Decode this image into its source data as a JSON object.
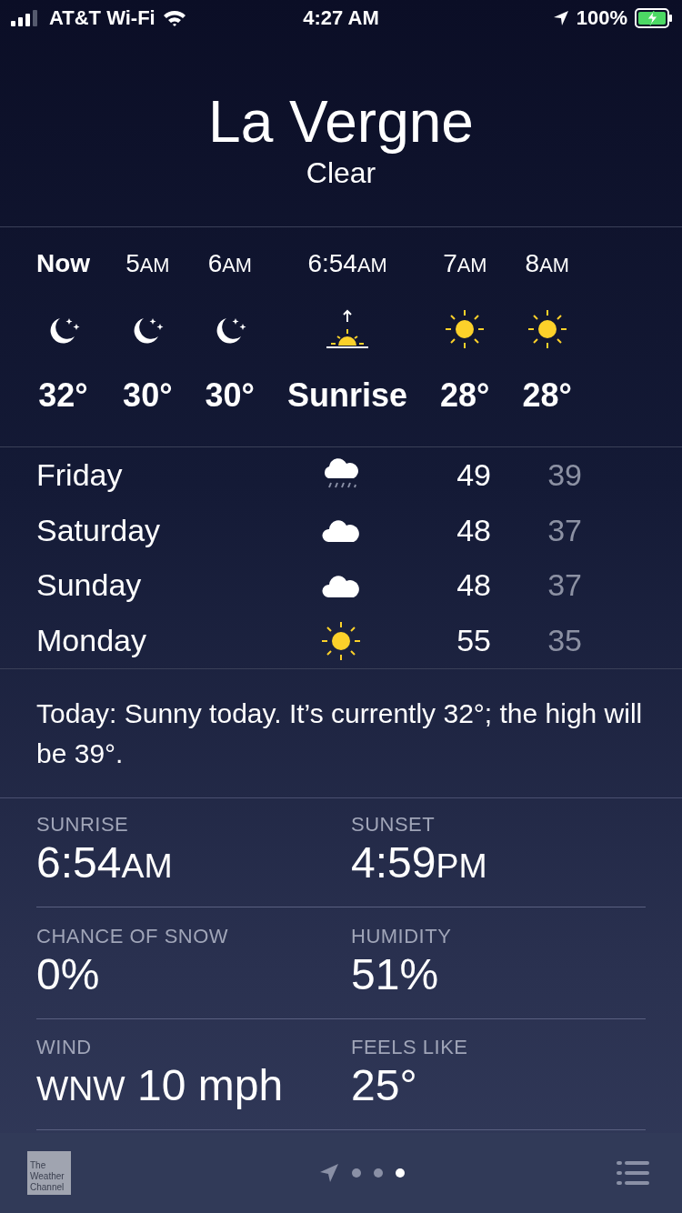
{
  "status_bar": {
    "carrier": "AT&T Wi-Fi",
    "time": "4:27 AM",
    "battery": "100%",
    "charging": true
  },
  "location": {
    "city": "La Vergne",
    "condition": "Clear"
  },
  "hourly": [
    {
      "time": "Now",
      "kind": "moon",
      "temp": "32°",
      "bold": true
    },
    {
      "time": "5",
      "period": "AM",
      "kind": "moon",
      "temp": "30°",
      "bold": false
    },
    {
      "time": "6",
      "period": "AM",
      "kind": "moon",
      "temp": "30°",
      "bold": false
    },
    {
      "time": "6:54",
      "period": "AM",
      "kind": "sunrise",
      "temp": "Sunrise",
      "bold": false
    },
    {
      "time": "7",
      "period": "AM",
      "kind": "sun",
      "temp": "28°",
      "bold": false
    },
    {
      "time": "8",
      "period": "AM",
      "kind": "sun",
      "temp": "28°",
      "bold": false
    }
  ],
  "daily": [
    {
      "day": "Friday",
      "kind": "rain",
      "high": "49",
      "low": "39"
    },
    {
      "day": "Saturday",
      "kind": "cloud",
      "high": "48",
      "low": "37"
    },
    {
      "day": "Sunday",
      "kind": "cloud",
      "high": "48",
      "low": "37"
    },
    {
      "day": "Monday",
      "kind": "sun",
      "high": "55",
      "low": "35"
    }
  ],
  "summary": "Today: Sunny today. It’s currently 32°; the high will be 39°.",
  "details": [
    {
      "label": "SUNRISE",
      "value": "6:54",
      "suffix": "AM"
    },
    {
      "label": "SUNSET",
      "value": "4:59",
      "suffix": "PM"
    },
    {
      "label": "CHANCE OF SNOW",
      "value": "0%"
    },
    {
      "label": "HUMIDITY",
      "value": "51%"
    },
    {
      "label": "WIND",
      "prefix": "WNW",
      "value": "10 mph"
    },
    {
      "label": "FEELS LIKE",
      "value": "25°"
    }
  ],
  "bottom_bar": {
    "logo_lines": [
      "The",
      "Weather",
      "Channel"
    ],
    "pages": [
      {
        "selected": false
      },
      {
        "selected": false
      },
      {
        "selected": true
      }
    ]
  }
}
